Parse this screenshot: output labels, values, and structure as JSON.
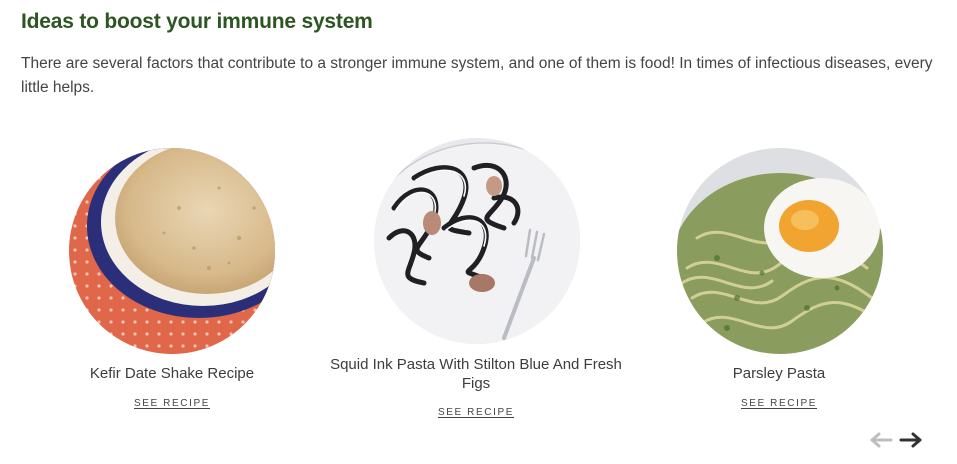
{
  "section": {
    "title": "Ideas to boost your immune system",
    "intro": "There are several factors that contribute to a stronger immune system, and one of them is food! In times of infectious diseases, every little helps."
  },
  "recipes": [
    {
      "name": "Kefir Date Shake Recipe",
      "link_label": "SEE RECIPE",
      "image_icon": "kefir-shake-photo"
    },
    {
      "name": "Squid Ink Pasta With Stilton Blue And Fresh Figs",
      "link_label": "SEE RECIPE",
      "image_icon": "squid-ink-pasta-photo"
    },
    {
      "name": "Parsley Pasta",
      "link_label": "SEE RECIPE",
      "image_icon": "parsley-pasta-photo"
    }
  ],
  "carousel": {
    "prev_icon": "arrow-left-icon",
    "next_icon": "arrow-right-icon",
    "prev_color": "#bdbdbd",
    "next_color": "#333333"
  },
  "colors": {
    "heading": "#2c5521",
    "text": "#444444"
  }
}
